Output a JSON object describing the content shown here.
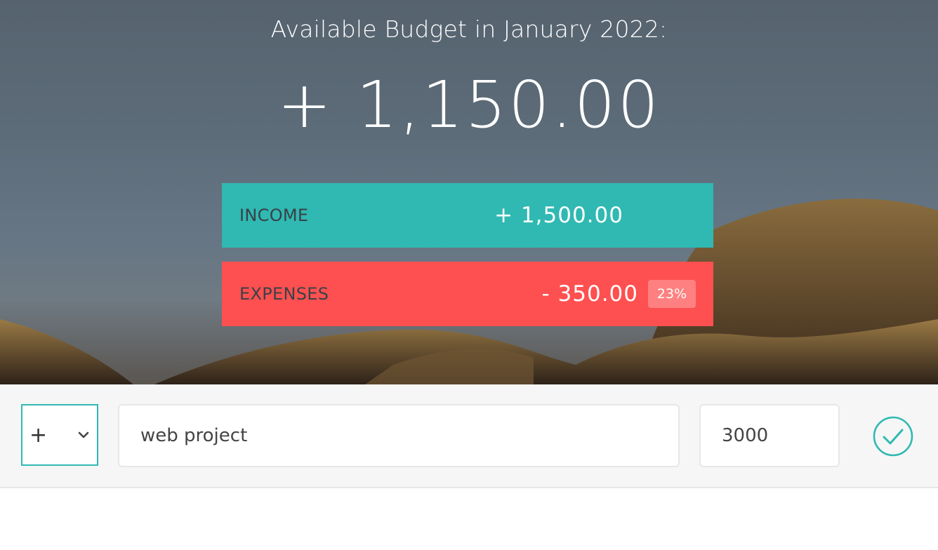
{
  "header": {
    "title": "Available Budget in January 2022:",
    "budget": "+ 1,150.00"
  },
  "summary": {
    "income": {
      "label": "INCOME",
      "value": "+ 1,500.00"
    },
    "expenses": {
      "label": "EXPENSES",
      "value": "- 350.00",
      "percentage": "23%"
    }
  },
  "add_form": {
    "type_value": "+",
    "description_value": "web project",
    "amount_value": "3000"
  },
  "colors": {
    "income": "#2fb9b2",
    "expenses": "#fe5050",
    "accent": "#2fb9b2"
  },
  "icons": {
    "dropdown": "chevron-down-icon",
    "submit": "checkmark-circle-icon"
  }
}
